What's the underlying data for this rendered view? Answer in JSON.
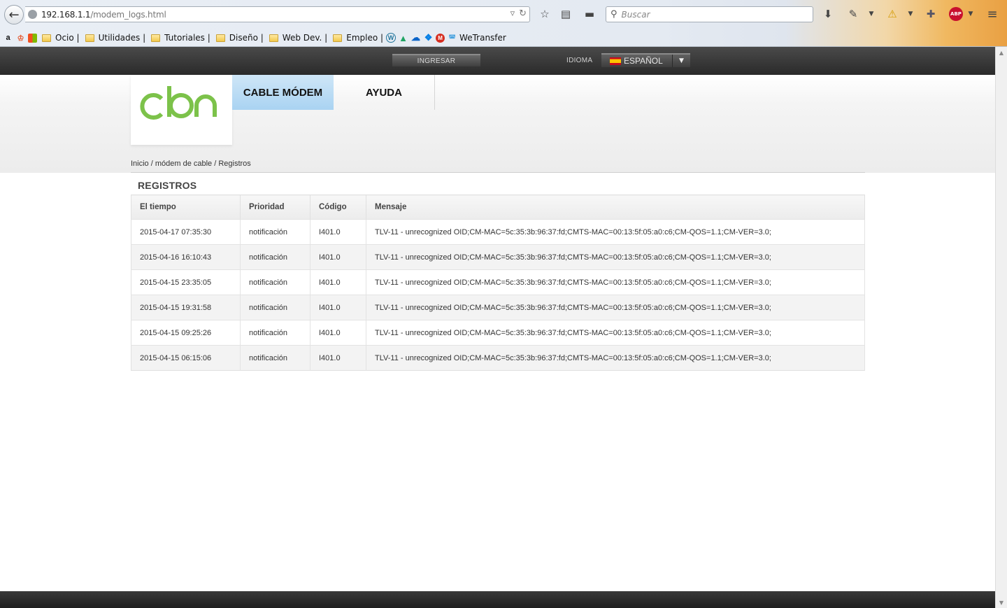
{
  "browser": {
    "url_host": "192.168.1.1",
    "url_path": "/modem_logs.html",
    "search_placeholder": "Buscar",
    "bookmarks": [
      {
        "label": "Ocio |",
        "type": "folder"
      },
      {
        "label": "Utilidades |",
        "type": "folder"
      },
      {
        "label": "Tutoriales |",
        "type": "folder"
      },
      {
        "label": "Diseño |",
        "type": "folder"
      },
      {
        "label": "Web Dev. |",
        "type": "folder"
      },
      {
        "label": "Empleo |",
        "type": "folder"
      },
      {
        "label": "WeTransfer",
        "type": "link"
      }
    ]
  },
  "topbar": {
    "login_label": "INGRESAR",
    "language_label": "IDIOMA",
    "language_value": "ESPAÑOL"
  },
  "nav": {
    "cable_modem": "CABLE MÓDEM",
    "help": "AYUDA"
  },
  "breadcrumb": "Inicio / módem de cable / Registros",
  "logs": {
    "title": "REGISTROS",
    "columns": [
      "El tiempo",
      "Prioridad",
      "Código",
      "Mensaje"
    ],
    "rows": [
      [
        "2015-04-17 07:35:30",
        "notificación",
        "I401.0",
        "TLV-11 - unrecognized OID;CM-MAC=5c:35:3b:96:37:fd;CMTS-MAC=00:13:5f:05:a0:c6;CM-QOS=1.1;CM-VER=3.0;"
      ],
      [
        "2015-04-16 16:10:43",
        "notificación",
        "I401.0",
        "TLV-11 - unrecognized OID;CM-MAC=5c:35:3b:96:37:fd;CMTS-MAC=00:13:5f:05:a0:c6;CM-QOS=1.1;CM-VER=3.0;"
      ],
      [
        "2015-04-15 23:35:05",
        "notificación",
        "I401.0",
        "TLV-11 - unrecognized OID;CM-MAC=5c:35:3b:96:37:fd;CMTS-MAC=00:13:5f:05:a0:c6;CM-QOS=1.1;CM-VER=3.0;"
      ],
      [
        "2015-04-15 19:31:58",
        "notificación",
        "I401.0",
        "TLV-11 - unrecognized OID;CM-MAC=5c:35:3b:96:37:fd;CMTS-MAC=00:13:5f:05:a0:c6;CM-QOS=1.1;CM-VER=3.0;"
      ],
      [
        "2015-04-15 09:25:26",
        "notificación",
        "I401.0",
        "TLV-11 - unrecognized OID;CM-MAC=5c:35:3b:96:37:fd;CMTS-MAC=00:13:5f:05:a0:c6;CM-QOS=1.1;CM-VER=3.0;"
      ],
      [
        "2015-04-15 06:15:06",
        "notificación",
        "I401.0",
        "TLV-11 - unrecognized OID;CM-MAC=5c:35:3b:96:37:fd;CMTS-MAC=00:13:5f:05:a0:c6;CM-QOS=1.1;CM-VER=3.0;"
      ]
    ]
  },
  "colors": {
    "logo_green": "#7cc24a",
    "active_tab": "#b8dcf5",
    "topbar": "#333333"
  }
}
